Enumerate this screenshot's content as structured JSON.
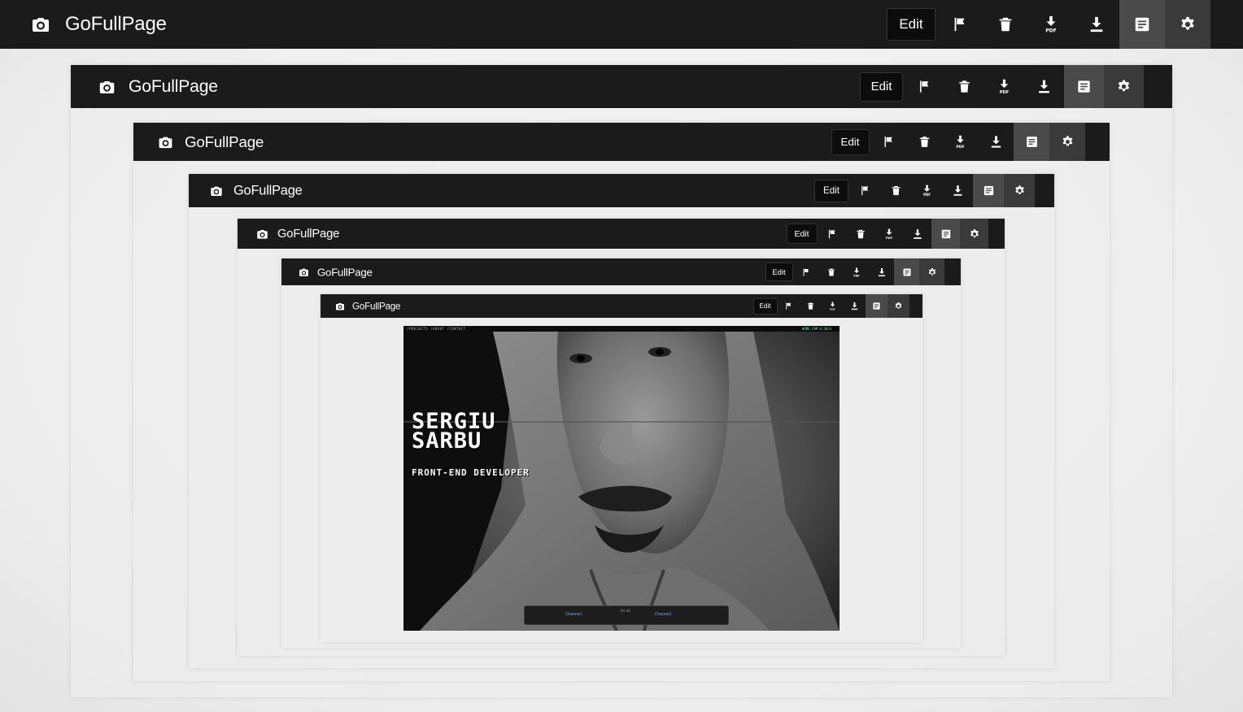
{
  "app": {
    "title": "GoFullPage"
  },
  "toolbar": {
    "edit_label": "Edit",
    "tools": [
      {
        "icon": "flag-icon"
      },
      {
        "icon": "trash-icon"
      },
      {
        "icon": "download-pdf-icon",
        "sub_label": "PDF"
      },
      {
        "icon": "download-icon"
      },
      {
        "icon": "document-icon"
      },
      {
        "icon": "gear-icon"
      }
    ]
  },
  "nested_levels": 7,
  "captured_page": {
    "nav_links": "/PROJECTS   /ABOUT   /CONTACT",
    "nav_time": "HOME-CAM 0:30/A",
    "name_line1": "SERGIU",
    "name_line2": "SARBU",
    "role": "FRONT-END DEVELOPER",
    "player_left": "Channel",
    "player_mid": "CH 01",
    "player_right": "Channel"
  },
  "colors": {
    "toolbar_bg": "#1b1b1b",
    "active_tool_bg": "#4a4a4a",
    "page_bg": "#f0f0f0"
  }
}
